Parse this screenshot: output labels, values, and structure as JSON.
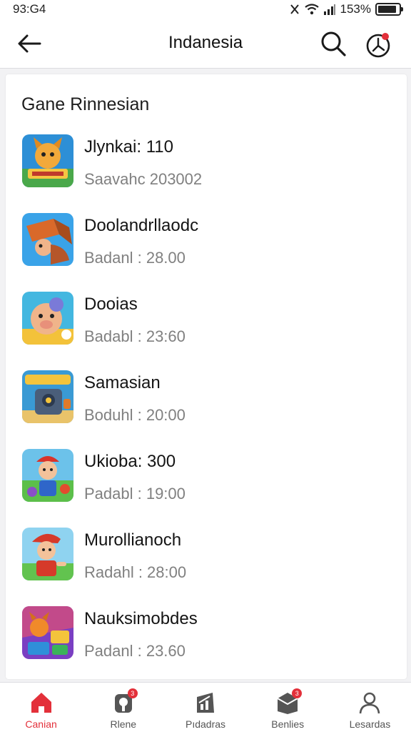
{
  "status_bar": {
    "time": "93:G4",
    "battery": "153%",
    "battery_level": 0.9
  },
  "app_bar": {
    "title": "Indanesia",
    "back_icon": "arrow-left-icon",
    "search_icon": "search-icon",
    "history_icon": "clock-alert-icon"
  },
  "section": {
    "title": "Gane Rinnesian"
  },
  "games": [
    {
      "name": "Jlynkai: 110",
      "meta": "Saavahc 203002",
      "icon": "fox-character-icon",
      "icon_colors": [
        "#2d8fd6",
        "#f2a93b"
      ]
    },
    {
      "name": "Doolandrllaodc",
      "meta": "Badanl : 28.00",
      "icon": "crate-character-icon",
      "icon_colors": [
        "#3aa3e8",
        "#d9692a"
      ]
    },
    {
      "name": "Dooias",
      "meta": "Badabl : 23:60",
      "icon": "pig-character-icon",
      "icon_colors": [
        "#43b7e0",
        "#f0b48a"
      ]
    },
    {
      "name": "Samasian",
      "meta": "Boduhl : 20:00",
      "icon": "safe-box-icon",
      "icon_colors": [
        "#3a9ad4",
        "#4a5e7a"
      ]
    },
    {
      "name": "Ukioba: 300",
      "meta": "Padabl : 19:00",
      "icon": "boy-character-icon",
      "icon_colors": [
        "#5cbf4a",
        "#d9342b"
      ]
    },
    {
      "name": "Murollianoch",
      "meta": "Radahl : 28:00",
      "icon": "hero-character-icon",
      "icon_colors": [
        "#62c34f",
        "#d63a2a"
      ]
    },
    {
      "name": "Nauksimobdes",
      "meta": "Padanl : 23.60",
      "icon": "puzzle-character-icon",
      "icon_colors": [
        "#7a3fc2",
        "#f08a2a"
      ]
    }
  ],
  "bottom_nav": [
    {
      "label": "Canian",
      "icon": "home-icon",
      "badge": "",
      "active": true
    },
    {
      "label": "Rlene",
      "icon": "pin-icon",
      "badge": "3",
      "active": false
    },
    {
      "label": "Pıdadras",
      "icon": "chart-box-icon",
      "badge": "",
      "active": false
    },
    {
      "label": "Benlies",
      "icon": "inbox-icon",
      "badge": "3",
      "active": false
    },
    {
      "label": "Lesardas",
      "icon": "person-icon",
      "badge": "",
      "active": false
    }
  ],
  "colors": {
    "accent": "#e3303a",
    "meta_text": "#808080",
    "background": "#f2f2f4"
  }
}
